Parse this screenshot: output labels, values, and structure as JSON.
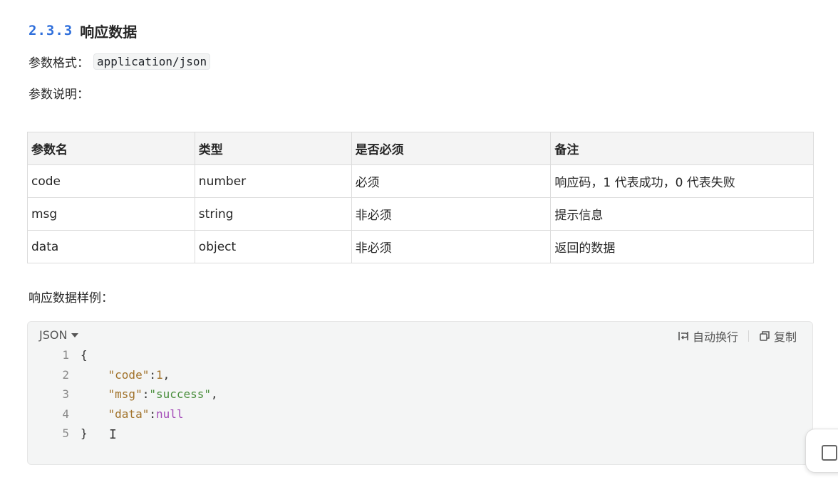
{
  "section": {
    "number": "2.3.3",
    "title": "响应数据"
  },
  "format": {
    "label": "参数格式：",
    "value": "application/json"
  },
  "desc_label": "参数说明：",
  "table": {
    "headers": [
      "参数名",
      "类型",
      "是否必须",
      "备注"
    ],
    "rows": [
      [
        "code",
        "number",
        "必须",
        "响应码，1 代表成功，0 代表失败"
      ],
      [
        "msg",
        "string",
        "非必须",
        "提示信息"
      ],
      [
        "data",
        "object",
        "非必须",
        "返回的数据"
      ]
    ]
  },
  "sample_label": "响应数据样例：",
  "code_block": {
    "language": "JSON",
    "wrap_label": "自动换行",
    "copy_label": "复制",
    "lines": [
      {
        "n": "1",
        "text": "{"
      },
      {
        "n": "2",
        "key": "\"code\"",
        "sep": ":",
        "value": "1",
        "tail": ","
      },
      {
        "n": "3",
        "key": "\"msg\"",
        "sep": ":",
        "value": "\"success\"",
        "tail": ","
      },
      {
        "n": "4",
        "key": "\"data\"",
        "sep": ":",
        "value": "null",
        "tail": ""
      },
      {
        "n": "5",
        "text": "}"
      }
    ]
  },
  "colors": {
    "accent": "#2f6fdb",
    "key": "#a1722a",
    "string": "#4b8f3e",
    "null": "#a44bb8"
  }
}
